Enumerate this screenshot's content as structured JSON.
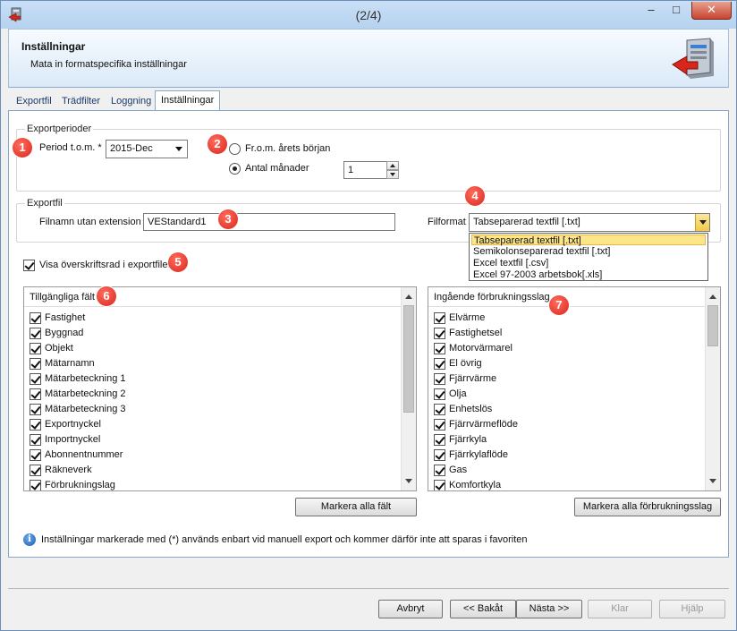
{
  "window": {
    "title": "(2/4)",
    "minimize": "–",
    "maximize": "□",
    "close": "✕"
  },
  "header": {
    "title": "Inställningar",
    "subtitle": "Mata in formatspecifika inställningar"
  },
  "tabs": [
    {
      "label": "Exportfil",
      "active": false
    },
    {
      "label": "Trädfilter",
      "active": false
    },
    {
      "label": "Loggning",
      "active": false
    },
    {
      "label": "Inställningar",
      "active": true
    }
  ],
  "export_periods": {
    "group_title": "Exportperioder",
    "period_label": "Period t.o.m. *",
    "period_value": "2015-Dec",
    "radio_from_start": "Fr.o.m. årets början",
    "radio_months": "Antal månader",
    "months_value": "1",
    "selected_radio": "months"
  },
  "export_file": {
    "group_title": "Exportfil",
    "filename_label": "Filnamn utan extension",
    "filename_value": "VEStandard1",
    "format_label": "Filformat",
    "format_value": "Tabseparerad textfil [.txt]",
    "format_options": [
      "Tabseparerad textfil [.txt]",
      "Semikolonseparerad textfil [.txt]",
      "Excel textfil [.csv]",
      "Excel 97-2003 arbetsbok[.xls]"
    ]
  },
  "show_header_row": {
    "label": "Visa överskriftsrad i exportfilen",
    "checked": true
  },
  "available_fields": {
    "title": "Tillgängliga fält",
    "items": [
      "Fastighet",
      "Byggnad",
      "Objekt",
      "Mätarnamn",
      "Mätarbeteckning 1",
      "Mätarbeteckning 2",
      "Mätarbeteckning 3",
      "Exportnyckel",
      "Importnyckel",
      "Abonnentnummer",
      "Räkneverk",
      "Förbrukningslag"
    ],
    "button": "Markera alla fält"
  },
  "consumption_types": {
    "title": "Ingående förbrukningsslag",
    "items": [
      "Elvärme",
      "Fastighetsel",
      "Motorvärmarel",
      "El övrig",
      "Fjärrvärme",
      "Olja",
      "Enhetslös",
      "Fjärrvärmeflöde",
      "Fjärrkyla",
      "Fjärrkylaflöde",
      "Gas",
      "Komfortkyla"
    ],
    "button": "Markera alla förbrukningsslag"
  },
  "info_text": "Inställningar markerade med (*) används enbart vid manuell export och kommer därför inte att sparas i favoriten",
  "badges": [
    "1",
    "2",
    "3",
    "4",
    "5",
    "6",
    "7"
  ],
  "footer": {
    "cancel": "Avbryt",
    "back": "<< Bakåt",
    "next": "Nästa >>",
    "finish": "Klar",
    "help": "Hjälp"
  },
  "colors": {
    "accent_badge": "#d9261c",
    "dropdown_highlight": "#fde68a",
    "title_bar": "#c9dff5"
  }
}
